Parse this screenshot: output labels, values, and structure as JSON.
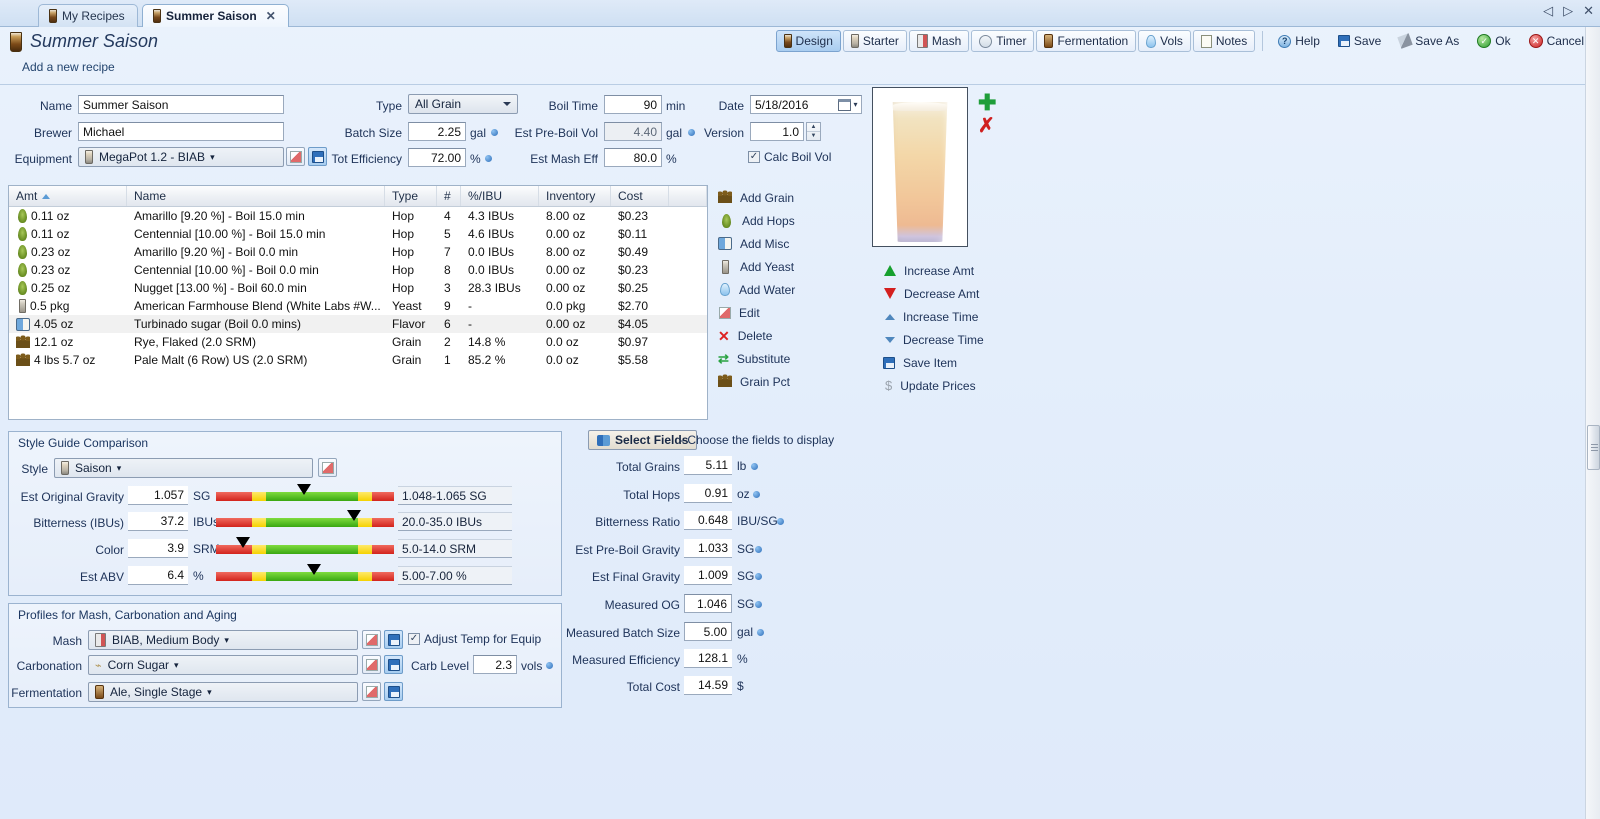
{
  "window": {
    "controls": [
      "◁",
      "▷",
      "✕"
    ]
  },
  "tabs": [
    {
      "label": "My Recipes",
      "active": false,
      "closable": false
    },
    {
      "label": "Summer Saison",
      "active": true,
      "closable": true,
      "close": "✕"
    }
  ],
  "header": {
    "title": "Summer Saison",
    "subtitle": "Add a new recipe"
  },
  "toolbar": {
    "view_buttons": [
      {
        "label": "Design",
        "icon": "beer-glass-icon",
        "selected": true
      },
      {
        "label": "Starter",
        "icon": "yeast-vial-icon",
        "selected": false
      },
      {
        "label": "Mash",
        "icon": "mash-tun-icon",
        "selected": false
      },
      {
        "label": "Timer",
        "icon": "clock-icon",
        "selected": false
      },
      {
        "label": "Fermentation",
        "icon": "fermenter-icon",
        "selected": false
      },
      {
        "label": "Vols",
        "icon": "water-drop-icon",
        "selected": false
      },
      {
        "label": "Notes",
        "icon": "notepad-icon",
        "selected": false
      }
    ],
    "action_buttons": [
      {
        "label": "Help",
        "icon": "help-icon"
      },
      {
        "label": "Save",
        "icon": "save-icon"
      },
      {
        "label": "Save As",
        "icon": "save-as-icon"
      },
      {
        "label": "Ok",
        "icon": "check-circle-icon"
      },
      {
        "label": "Cancel",
        "icon": "cancel-circle-icon"
      }
    ]
  },
  "recipe_form": {
    "name_label": "Name",
    "name_value": "Summer Saison",
    "brewer_label": "Brewer",
    "brewer_value": "Michael",
    "equipment_label": "Equipment",
    "equipment_value": "MegaPot 1.2 - BIAB",
    "type_label": "Type",
    "type_value": "All Grain",
    "batch_size_label": "Batch Size",
    "batch_size_value": "2.25",
    "batch_size_unit": "gal",
    "tot_efficiency_label": "Tot Efficiency",
    "tot_efficiency_value": "72.00",
    "tot_efficiency_unit": "%",
    "boil_time_label": "Boil Time",
    "boil_time_value": "90",
    "boil_time_unit": "min",
    "est_preboil_vol_label": "Est Pre-Boil Vol",
    "est_preboil_vol_value": "4.40",
    "est_preboil_vol_unit": "gal",
    "est_mash_eff_label": "Est Mash Eff",
    "est_mash_eff_value": "80.0",
    "est_mash_eff_unit": "%",
    "date_label": "Date",
    "date_value": "5/18/2016",
    "version_label": "Version",
    "version_value": "1.0",
    "calc_boil_vol_label": "Calc Boil Vol",
    "calc_boil_vol_checked": "✓"
  },
  "ingredients": {
    "columns": [
      "Amt",
      "Name",
      "Type",
      "#",
      "%/IBU",
      "Inventory",
      "Cost"
    ],
    "sort_column": "Amt",
    "rows": [
      {
        "icon": "hop-icon",
        "amt": "0.11 oz",
        "name": "Amarillo [9.20 %] - Boil 15.0 min",
        "type": "Hop",
        "num": "4",
        "pct": "4.3 IBUs",
        "inventory": "8.00 oz",
        "cost": "$0.23"
      },
      {
        "icon": "hop-icon",
        "amt": "0.11 oz",
        "name": "Centennial [10.00 %] - Boil 15.0 min",
        "type": "Hop",
        "num": "5",
        "pct": "4.6 IBUs",
        "inventory": "0.00 oz",
        "cost": "$0.11"
      },
      {
        "icon": "hop-icon",
        "amt": "0.23 oz",
        "name": "Amarillo [9.20 %] - Boil 0.0 min",
        "type": "Hop",
        "num": "7",
        "pct": "0.0 IBUs",
        "inventory": "8.00 oz",
        "cost": "$0.49"
      },
      {
        "icon": "hop-icon",
        "amt": "0.23 oz",
        "name": "Centennial [10.00 %] - Boil 0.0 min",
        "type": "Hop",
        "num": "8",
        "pct": "0.0 IBUs",
        "inventory": "0.00 oz",
        "cost": "$0.23"
      },
      {
        "icon": "hop-icon",
        "amt": "0.25 oz",
        "name": "Nugget [13.00 %] - Boil 60.0 min",
        "type": "Hop",
        "num": "3",
        "pct": "28.3 IBUs",
        "inventory": "0.00 oz",
        "cost": "$0.25"
      },
      {
        "icon": "yeast-icon",
        "amt": "0.5 pkg",
        "name": "American Farmhouse Blend (White Labs #W...",
        "type": "Yeast",
        "num": "9",
        "pct": "-",
        "inventory": "0.0 pkg",
        "cost": "$2.70"
      },
      {
        "icon": "misc-icon",
        "amt": "4.05 oz",
        "name": "Turbinado sugar (Boil 0.0 mins)",
        "type": "Flavor",
        "num": "6",
        "pct": "-",
        "inventory": "0.00 oz",
        "cost": "$4.05",
        "selected": true
      },
      {
        "icon": "grain-icon",
        "amt": "12.1 oz",
        "name": "Rye, Flaked (2.0 SRM)",
        "type": "Grain",
        "num": "2",
        "pct": "14.8 %",
        "inventory": "0.0 oz",
        "cost": "$0.97"
      },
      {
        "icon": "grain-icon",
        "amt": "4 lbs 5.7 oz",
        "name": "Pale Malt (6 Row) US (2.0 SRM)",
        "type": "Grain",
        "num": "1",
        "pct": "85.2 %",
        "inventory": "0.0 oz",
        "cost": "$5.58"
      }
    ]
  },
  "ingredient_actions": [
    {
      "label": "Add Grain",
      "icon": "grain-icon"
    },
    {
      "label": "Add Hops",
      "icon": "hop-icon"
    },
    {
      "label": "Add Misc",
      "icon": "misc-icon"
    },
    {
      "label": "Add Yeast",
      "icon": "yeast-icon"
    },
    {
      "label": "Add Water",
      "icon": "water-drop-icon"
    },
    {
      "label": "Edit",
      "icon": "edit-icon"
    },
    {
      "label": "Delete",
      "icon": "delete-x-icon"
    },
    {
      "label": "Substitute",
      "icon": "substitute-arrows-icon"
    },
    {
      "label": "Grain Pct",
      "icon": "grain-icon"
    }
  ],
  "amount_actions": [
    {
      "label": "Increase Amt",
      "icon": "arrow-up-green-icon"
    },
    {
      "label": "Decrease Amt",
      "icon": "arrow-down-red-icon"
    },
    {
      "label": "Increase Time",
      "icon": "arrow-up-blue-icon"
    },
    {
      "label": "Decrease Time",
      "icon": "arrow-down-blue-icon"
    },
    {
      "label": "Save Item",
      "icon": "save-icon"
    },
    {
      "label": "Update Prices",
      "icon": "dollar-icon"
    }
  ],
  "preview": {
    "add_icon": "plus-icon",
    "remove_icon": "red-x-icon"
  },
  "style_guide": {
    "panel_title": "Style Guide Comparison",
    "style_label": "Style",
    "style_value": "Saison",
    "rows": [
      {
        "label": "Est Original Gravity",
        "value": "1.057",
        "unit": "SG",
        "range": "1.048-1.065 SG",
        "marker_pct": 57
      },
      {
        "label": "Bitterness (IBUs)",
        "value": "37.2",
        "unit": "IBUs",
        "range": "20.0-35.0 IBUs",
        "marker_pct": 86
      },
      {
        "label": "Color",
        "value": "3.9",
        "unit": "SRM",
        "range": "5.0-14.0 SRM",
        "marker_pct": 23
      },
      {
        "label": "Est ABV",
        "value": "6.4",
        "unit": "%",
        "range": "5.00-7.00 %",
        "marker_pct": 62
      }
    ]
  },
  "profiles": {
    "panel_title": "Profiles for Mash, Carbonation and Aging",
    "mash_label": "Mash",
    "mash_value": "BIAB, Medium Body",
    "adjust_temp_label": "Adjust Temp for Equip",
    "adjust_temp_checked": "✓",
    "carbonation_label": "Carbonation",
    "carbonation_value": "Corn Sugar",
    "carb_level_label": "Carb Level",
    "carb_level_value": "2.3",
    "carb_level_unit": "vols",
    "fermentation_label": "Fermentation",
    "fermentation_value": "Ale, Single Stage"
  },
  "stats": {
    "select_fields_label": "Select Fields",
    "select_fields_hint": "- Choose the fields to display",
    "rows": [
      {
        "label": "Total Grains",
        "value": "5.11",
        "unit": "lb",
        "dot": true,
        "editable": false
      },
      {
        "label": "Total Hops",
        "value": "0.91",
        "unit": "oz",
        "dot": true,
        "editable": false
      },
      {
        "label": "Bitterness Ratio",
        "value": "0.648",
        "unit": "IBU/SG",
        "dot": true,
        "editable": false
      },
      {
        "label": "Est Pre-Boil Gravity",
        "value": "1.033",
        "unit": "SG",
        "dot": true,
        "editable": false
      },
      {
        "label": "Est Final Gravity",
        "value": "1.009",
        "unit": "SG",
        "dot": true,
        "editable": false
      },
      {
        "label": "Measured OG",
        "value": "1.046",
        "unit": "SG",
        "dot": true,
        "editable": true
      },
      {
        "label": "Measured Batch Size",
        "value": "5.00",
        "unit": "gal",
        "dot": true,
        "editable": true
      },
      {
        "label": "Measured Efficiency",
        "value": "128.1",
        "unit": "%",
        "dot": false,
        "editable": false
      },
      {
        "label": "Total Cost",
        "value": "14.59",
        "unit": "$",
        "dot": false,
        "editable": false
      }
    ]
  },
  "colors": {
    "accent": "#2f6fba",
    "panel_bg": "#e8f1fb",
    "good": "#39a712",
    "warn": "#f5d200",
    "bad": "#d2231c"
  }
}
